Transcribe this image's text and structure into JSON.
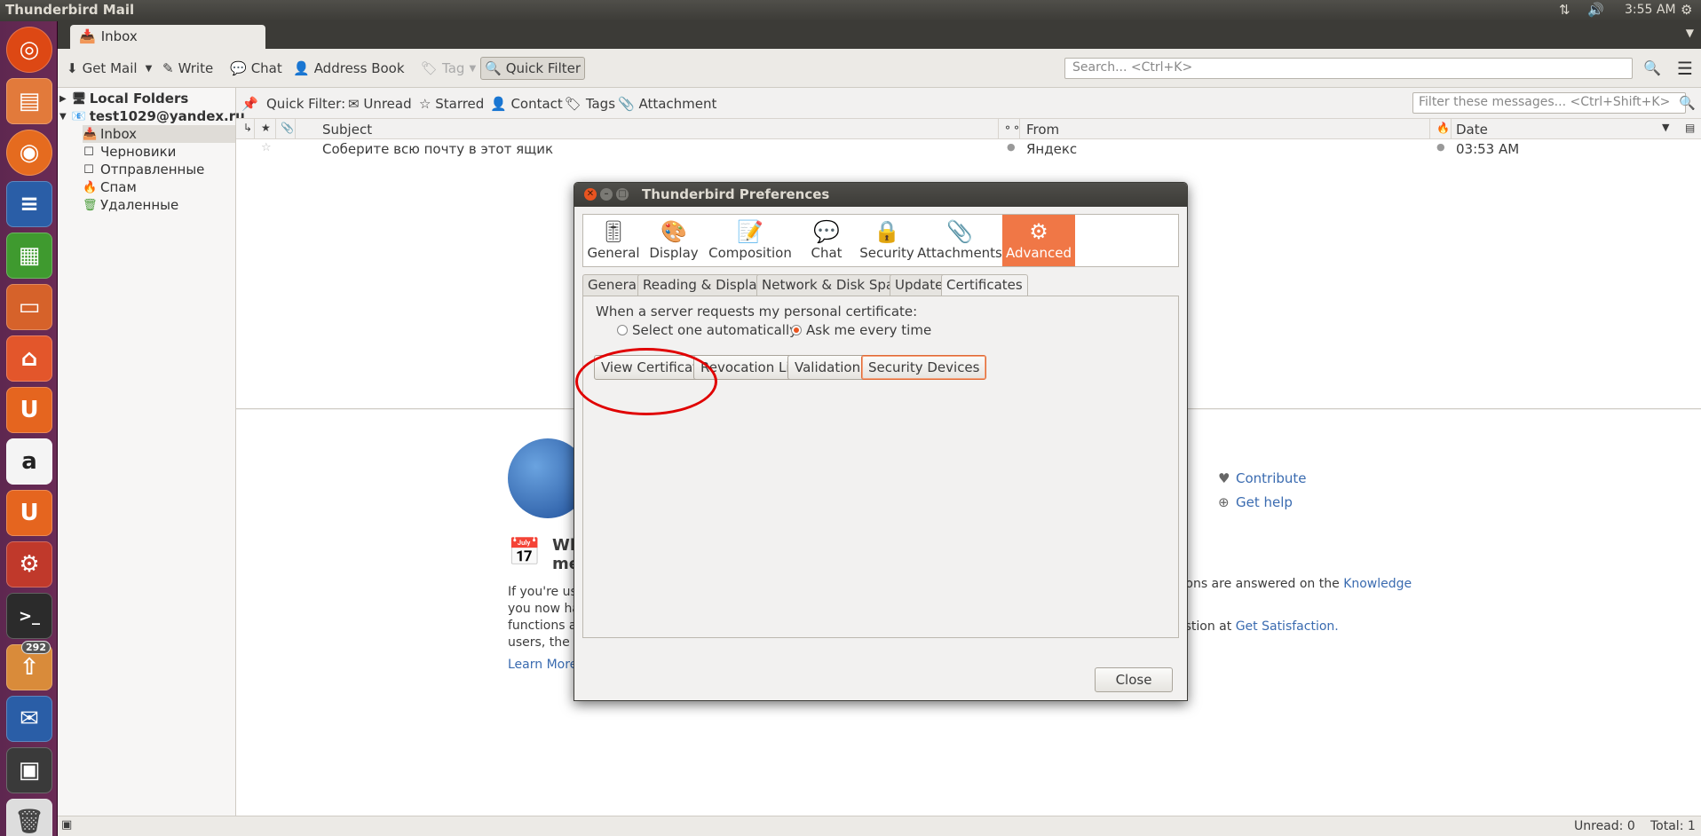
{
  "panel": {
    "app_title": "Thunderbird Mail",
    "time": "3:55 AM"
  },
  "launcher": {
    "badge_count": "292"
  },
  "tab": {
    "label": "Inbox"
  },
  "toolbar": {
    "get_mail": "Get Mail",
    "write": "Write",
    "chat": "Chat",
    "address_book": "Address Book",
    "tag": "Tag",
    "quick_filter": "Quick Filter",
    "search_placeholder": "Search... <Ctrl+K>"
  },
  "folders": {
    "local": "Local Folders",
    "account": "test1029@yandex.ru",
    "inbox": "Inbox",
    "drafts": "Черновики",
    "sent": "Отправленные",
    "spam": "Спам",
    "deleted": "Удаленные"
  },
  "quickfilter": {
    "label": "Quick Filter:",
    "unread": "Unread",
    "starred": "Starred",
    "contact": "Contact",
    "tags": "Tags",
    "attachment": "Attachment",
    "placeholder": "Filter these messages... <Ctrl+Shift+K>"
  },
  "columns": {
    "subject": "Subject",
    "from": "From",
    "date": "Date"
  },
  "message": {
    "subject": "Соберите всю почту в этот ящик",
    "from": "Яндекс",
    "date": "03:53 AM"
  },
  "start_page": {
    "contribute": "Contribute",
    "get_help": "Get help",
    "heading1": "Wh",
    "heading2": "me",
    "p1": "If you're usi",
    "p2": "you now hav",
    "p3": "functions ar",
    "p4": "users, the m",
    "right1": "tions are answered on the ",
    "knowledge": "Knowledge",
    "right2": "estion at ",
    "satisfaction": "Get Satisfaction.",
    "learn_more": "Learn More"
  },
  "status": {
    "unread": "Unread: 0",
    "total": "Total: 1"
  },
  "dialog": {
    "title": "Thunderbird Preferences",
    "panes": [
      "General",
      "Display",
      "Composition",
      "Chat",
      "Security",
      "Attachments",
      "Advanced"
    ],
    "subtabs": [
      "General",
      "Reading & Display",
      "Network & Disk Space",
      "Update",
      "Certificates"
    ],
    "cert_prompt": "When a server requests my personal certificate:",
    "radio_auto": "Select one automatically",
    "radio_ask": "Ask me every time",
    "btn_view": "View Certificates",
    "btn_revocation": "Revocation Lists",
    "btn_validation": "Validation",
    "btn_devices": "Security Devices",
    "btn_close": "Close"
  },
  "colors": {
    "accent": "#f07746",
    "launcher": "#5e2750",
    "highlight_ellipse": "#e00000"
  }
}
